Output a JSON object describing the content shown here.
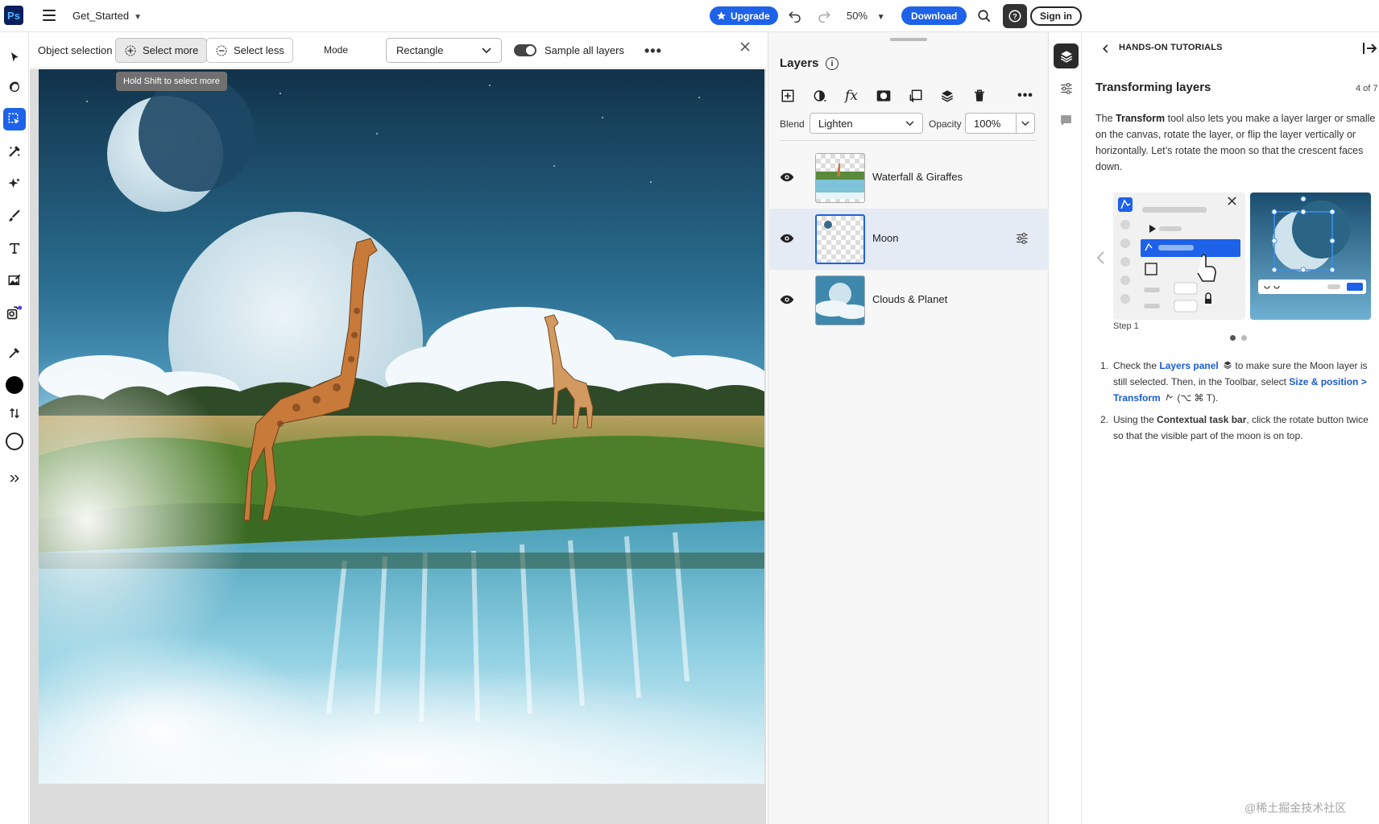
{
  "app": {
    "logo": "Ps",
    "document_name": "Get_Started",
    "upgrade_label": "Upgrade",
    "zoom": "50%",
    "download_label": "Download",
    "signin_label": "Sign in"
  },
  "options_bar": {
    "tool_name": "Object selection",
    "select_more": "Select more",
    "select_less": "Select less",
    "mode_label": "Mode",
    "mode_value": "Rectangle",
    "sample_all_layers": "Sample all layers",
    "sample_all_layers_on": true,
    "tooltip": "Hold Shift to select more"
  },
  "layers_panel": {
    "title": "Layers",
    "blend_label": "Blend",
    "blend_value": "Lighten",
    "opacity_label": "Opacity",
    "opacity_value": "100%",
    "layers": [
      {
        "name": "Waterfall & Giraffes",
        "visible": true,
        "selected": false
      },
      {
        "name": "Moon",
        "visible": true,
        "selected": true
      },
      {
        "name": "Clouds & Planet",
        "visible": true,
        "selected": false
      }
    ]
  },
  "tutorial": {
    "back_label": "HANDS-ON TUTORIALS",
    "title": "Transforming layers",
    "counter": "4 of 7",
    "intro_prefix": "The ",
    "intro_bold": "Transform",
    "intro_rest": " tool also lets you make a layer larger or smalle on the canvas, rotate the layer, or flip the layer vertically or horizontally. Let’s rotate the moon so that the crescent faces down.",
    "step_label": "Step 1",
    "steps": [
      {
        "num": "1.",
        "t1": "Check the ",
        "link1": "Layers panel",
        "t2": " to make sure the Moon layer is still selected. Then, in the Toolbar, select ",
        "link2": "Size & position > Transform",
        "t3": " (⌥ ⌘ T)."
      },
      {
        "num": "2.",
        "t1": "Using the ",
        "bold": "Contextual task bar",
        "t2": ", click the rotate button twice so that the visible part of the moon is on top."
      }
    ]
  },
  "watermark": "@稀土掘金技术社区",
  "colors": {
    "accent": "#1d62e8",
    "selected_layer_bg": "#e5ebf5",
    "canvas_bg": "#dcdcdc",
    "sky_top": "#11324a",
    "sky_bottom": "#5ab0d9"
  },
  "icons": {
    "tools": [
      "move-icon",
      "quick-actions-icon",
      "object-selection-icon",
      "healing-brush-icon",
      "generative-fill-icon",
      "brush-icon",
      "text-icon",
      "adjustments-icon",
      "add-image-icon",
      "eyedropper-icon",
      "foreground-color",
      "swap-colors-icon",
      "background-color",
      "more-tools-icon"
    ],
    "layer_actions": [
      "add-layer-icon",
      "adjustment-layer-icon",
      "fx-icon",
      "mask-icon",
      "clip-icon",
      "merge-icon",
      "delete-icon",
      "more-icon"
    ],
    "rail": [
      "layers-icon",
      "properties-icon",
      "comments-icon"
    ]
  }
}
